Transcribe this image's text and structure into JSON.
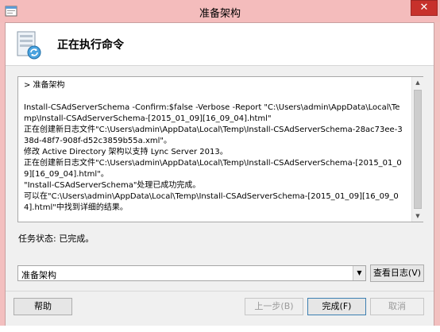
{
  "window": {
    "title": "准备架构",
    "close_label": "✕"
  },
  "header": {
    "title": "正在执行命令"
  },
  "log": {
    "text": "> 准备架构\n\nInstall-CSAdServerSchema -Confirm:$false -Verbose -Report \"C:\\Users\\admin\\AppData\\Local\\Temp\\Install-CSAdServerSchema-[2015_01_09][16_09_04].html\"\n正在创建新日志文件\"C:\\Users\\admin\\AppData\\Local\\Temp\\Install-CSAdServerSchema-28ac73ee-338d-48f7-908f-d52c3859b55a.xml\"。\n修改 Active Directory 架构以支持 Lync Server 2013。\n正在创建新日志文件\"C:\\Users\\admin\\AppData\\Local\\Temp\\Install-CSAdServerSchema-[2015_01_09][16_09_04].html\"。\n\"Install-CSAdServerSchema\"处理已成功完成。\n可以在\"C:\\Users\\admin\\AppData\\Local\\Temp\\Install-CSAdServerSchema-[2015_01_09][16_09_04].html\"中找到详细的结果。"
  },
  "status": {
    "text": "任务状态: 已完成。"
  },
  "selector": {
    "value": "准备架构",
    "view_log_label": "查看日志(V)"
  },
  "buttons": {
    "help": "帮助",
    "back": "上一步(B)",
    "finish": "完成(F)",
    "cancel": "取消"
  }
}
